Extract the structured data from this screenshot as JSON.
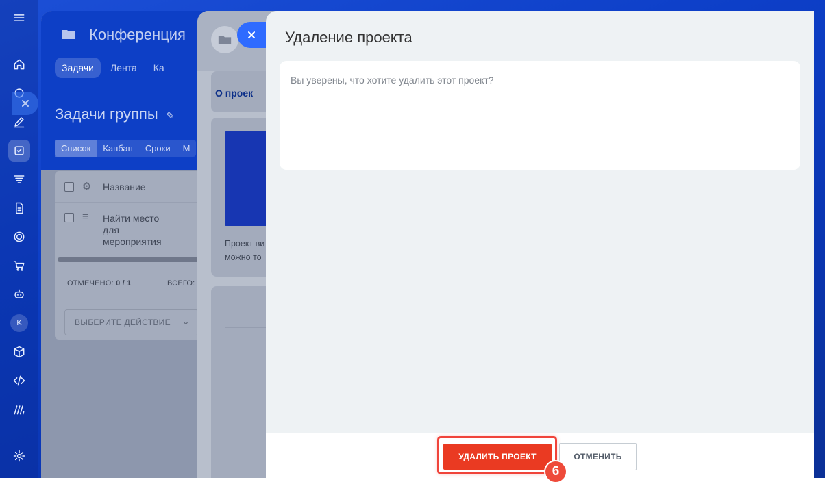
{
  "workspace": {
    "title": "Конференция",
    "tabs": [
      {
        "label": "Задачи"
      },
      {
        "label": "Лента"
      },
      {
        "label": "Ка"
      }
    ],
    "heading": "Задачи группы",
    "views": [
      {
        "label": "Список"
      },
      {
        "label": "Канбан"
      },
      {
        "label": "Сроки"
      },
      {
        "label": "М"
      }
    ],
    "table": {
      "column_name": "Название",
      "row_title": "Найти место для мероприятия",
      "marked_label": "ОТМЕЧЕНО:",
      "marked_value": "0 / 1",
      "total_label": "ВСЕГО:",
      "action_select": "ВЫБЕРИТЕ ДЕЙСТВИЕ"
    }
  },
  "project_slider": {
    "tab_label": "О проек",
    "description_line1": "Проект ви",
    "description_line2": "можно то"
  },
  "dialog": {
    "title": "Удаление проекта",
    "message": "Вы уверены, что хотите удалить этот проект?",
    "delete_label": "УДАЛИТЬ ПРОЕКТ",
    "cancel_label": "ОТМЕНИТЬ"
  },
  "rail": {
    "avatar_initial": "K"
  },
  "step_marker": "6",
  "colors": {
    "accent_blue": "#0d3fc6",
    "delete_red": "#ea3a22",
    "highlight_red": "#f0443a"
  }
}
